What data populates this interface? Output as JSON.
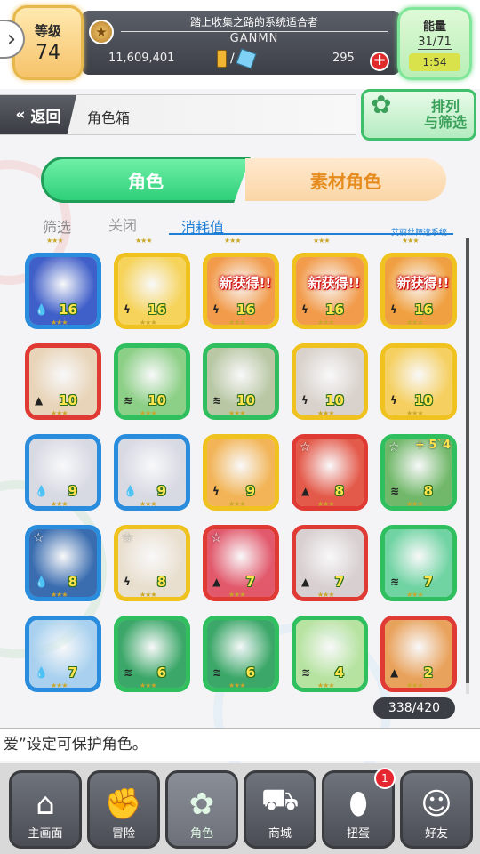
{
  "header": {
    "level_label": "等级",
    "level": "74",
    "title": "踏上收集之路的系统适合者",
    "username": "GANMN",
    "gold": "11,609,401",
    "separator": "/",
    "gems": "295",
    "stamina_label": "能量",
    "stamina": "31/71",
    "stamina_timer": "1:54"
  },
  "nav_top": {
    "back_label": "返回",
    "page_title": "角色箱",
    "sort_label_1": "排列",
    "sort_label_2": "与筛选"
  },
  "tabs": {
    "characters": "角色",
    "materials": "素材角色"
  },
  "filter": {
    "label": "筛选",
    "state": "关闭",
    "sort_value": "消耗值",
    "system_note": "艾丽丝筛选系统"
  },
  "cards": [
    {
      "level": "16",
      "frame": "#2a8cdc",
      "element": "water",
      "stars": "★★★",
      "art": "#3f5fc9",
      "new": ""
    },
    {
      "level": "16",
      "frame": "#f0c21f",
      "element": "thunder",
      "stars": "★★★",
      "art": "#f6d35a",
      "new": ""
    },
    {
      "level": "16",
      "frame": "#f0c21f",
      "element": "thunder",
      "stars": "★★★",
      "art": "#f29b4b",
      "new": "新获得!!"
    },
    {
      "level": "16",
      "frame": "#f0c21f",
      "element": "thunder",
      "stars": "★★★",
      "art": "#f29b4b",
      "new": "新获得!!"
    },
    {
      "level": "16",
      "frame": "#f0c21f",
      "element": "thunder",
      "stars": "★★★",
      "art": "#f0a040",
      "new": "新获得!!"
    },
    {
      "level": "10",
      "frame": "#e03a34",
      "element": "fire",
      "stars": "★★★",
      "art": "#e8d4b8",
      "new": ""
    },
    {
      "level": "10",
      "frame": "#2fbf5e",
      "element": "wind",
      "stars": "★★★",
      "art": "#8ccf86",
      "new": ""
    },
    {
      "level": "10",
      "frame": "#2fbf5e",
      "element": "wind",
      "stars": "★★★",
      "art": "#b9c7a4",
      "new": ""
    },
    {
      "level": "10",
      "frame": "#f0c21f",
      "element": "thunder",
      "stars": "★★★",
      "art": "#d9d2cc",
      "new": ""
    },
    {
      "level": "10",
      "frame": "#f0c21f",
      "element": "thunder",
      "stars": "★★★",
      "art": "#f5cf60",
      "new": ""
    },
    {
      "level": "9",
      "frame": "#2a8cdc",
      "element": "water",
      "stars": "★★★",
      "art": "#d7d9e3",
      "new": ""
    },
    {
      "level": "9",
      "frame": "#2a8cdc",
      "element": "water",
      "stars": "★★★",
      "art": "#d7d9e3",
      "new": ""
    },
    {
      "level": "9",
      "frame": "#f0c21f",
      "element": "thunder",
      "stars": "★★★",
      "art": "#f2b456",
      "new": ""
    },
    {
      "level": "8",
      "frame": "#e03a34",
      "element": "fire",
      "stars": "★★★",
      "art": "#e45a4a",
      "new": "",
      "corner_star": "☆"
    },
    {
      "level": "8",
      "frame": "#2fbf5e",
      "element": "wind",
      "stars": "★★★",
      "art": "#72b86a",
      "new": "",
      "corner_star": "☆",
      "plus": "+ 5`4"
    },
    {
      "level": "8",
      "frame": "#2a8cdc",
      "element": "water",
      "stars": "★★★",
      "art": "#3a6db0",
      "new": "",
      "corner_star": "☆"
    },
    {
      "level": "8",
      "frame": "#f0c21f",
      "element": "thunder",
      "stars": "★★★",
      "art": "#e9dfcf",
      "new": "",
      "corner_star": "☆"
    },
    {
      "level": "7",
      "frame": "#e03a34",
      "element": "fire",
      "stars": "★★★",
      "art": "#e2596c",
      "new": "",
      "corner_star": "☆"
    },
    {
      "level": "7",
      "frame": "#e03a34",
      "element": "fire",
      "stars": "★★★",
      "art": "#d8cfd0",
      "new": ""
    },
    {
      "level": "7",
      "frame": "#2fbf5e",
      "element": "wind",
      "stars": "★★★",
      "art": "#6fd3a2",
      "new": ""
    },
    {
      "level": "7",
      "frame": "#2a8cdc",
      "element": "water",
      "stars": "★★★",
      "art": "#a9d1ef",
      "new": ""
    },
    {
      "level": "6",
      "frame": "#2fbf5e",
      "element": "wind",
      "stars": "★★★",
      "art": "#3ba768",
      "new": ""
    },
    {
      "level": "6",
      "frame": "#2fbf5e",
      "element": "wind",
      "stars": "★★★",
      "art": "#3ba768",
      "new": ""
    },
    {
      "level": "4",
      "frame": "#2fbf5e",
      "element": "wind",
      "stars": "★★★",
      "art": "#b6e3a0",
      "new": ""
    },
    {
      "level": "2",
      "frame": "#e03a34",
      "element": "fire",
      "stars": "★★★",
      "art": "#e9a25c",
      "new": ""
    }
  ],
  "top_row_stars": "★★★",
  "box_count": "338/420",
  "marquee_text": "爱”设定可保护角色。",
  "bottom_nav": [
    {
      "label": "主画面",
      "icon": "home-icon",
      "glyph": "⌂"
    },
    {
      "label": "冒险",
      "icon": "handshake-icon",
      "glyph": "✊"
    },
    {
      "label": "角色",
      "icon": "bunny-icon",
      "glyph": "✿"
    },
    {
      "label": "商城",
      "icon": "cart-icon",
      "glyph": "⛟"
    },
    {
      "label": "扭蛋",
      "icon": "egg-icon",
      "glyph": "⬮",
      "badge": "1"
    },
    {
      "label": "好友",
      "icon": "friends-icon",
      "glyph": "☺"
    }
  ]
}
